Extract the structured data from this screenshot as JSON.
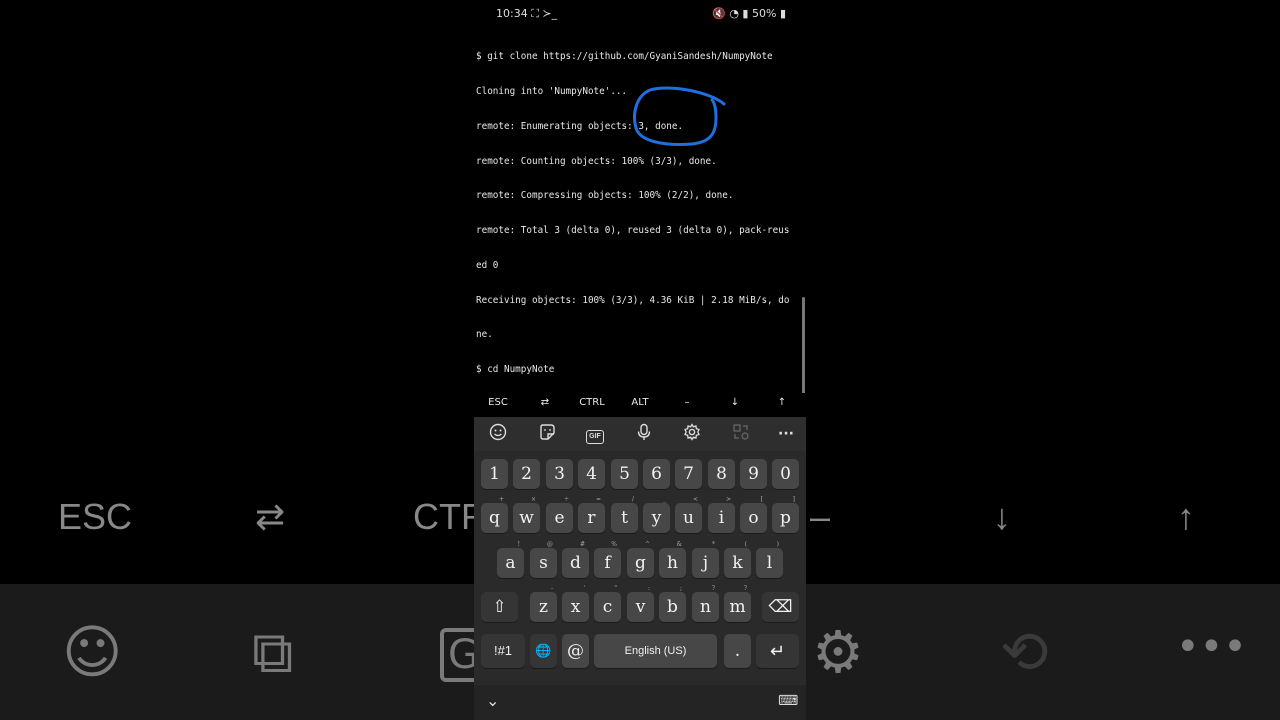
{
  "status_bar": {
    "time": "10:34",
    "notif_icons": "⛶ ≻_",
    "battery": "50%"
  },
  "terminal": {
    "lines": [
      "$ git clone https://github.com/GyaniSandesh/NumpyNote",
      "Cloning into 'NumpyNote'...",
      "remote: Enumerating objects: 3, done.",
      "remote: Counting objects: 100% (3/3), done.",
      "remote: Compressing objects: 100% (2/2), done.",
      "remote: Total 3 (delta 0), reused 3 (delta 0), pack-reus",
      "ed 0",
      "Receiving objects: 100% (3/3), 4.36 KiB | 2.18 MiB/s, do",
      "ne.",
      "$ cd NumpyNote",
      "$ "
    ]
  },
  "extra_keys": [
    "ESC",
    "⇄",
    "CTRL",
    "ALT",
    "–",
    "↓",
    "↑"
  ],
  "keyboard": {
    "toolbar_icons": [
      "emoji-icon",
      "sticker-icon",
      "gif-icon",
      "mic-icon",
      "settings-icon",
      "translate-icon",
      "more-icon"
    ],
    "gif_label": "GIF",
    "more_label": "···",
    "number_row": [
      "1",
      "2",
      "3",
      "4",
      "5",
      "6",
      "7",
      "8",
      "9",
      "0"
    ],
    "row1": [
      "q",
      "w",
      "e",
      "r",
      "t",
      "y",
      "u",
      "i",
      "o",
      "p"
    ],
    "row1_hints": [
      "+",
      "×",
      "÷",
      "=",
      "/",
      "_",
      "<",
      ">",
      "[",
      "]"
    ],
    "row2": [
      "a",
      "s",
      "d",
      "f",
      "g",
      "h",
      "j",
      "k",
      "l"
    ],
    "row2_hints": [
      "!",
      "@",
      "#",
      "%",
      "^",
      "&",
      "*",
      "(",
      ")"
    ],
    "row3": [
      "z",
      "x",
      "c",
      "v",
      "b",
      "n",
      "m"
    ],
    "row3_hints": [
      "-",
      "'",
      "\"",
      ":",
      ";",
      "?",
      "?"
    ],
    "shift": "⇧",
    "backspace": "⌫",
    "sym_label": "!#1",
    "lang_icon": "🌐",
    "at": "@",
    "space_label": "English (US)",
    "period": ".",
    "enter": "↵",
    "hide_icon": "⌄",
    "keyboard_icon": "⌨"
  },
  "background": {
    "extra_keys": [
      "ESC",
      "⇄",
      "CTR",
      "–",
      "↓",
      "↑"
    ],
    "tool_icons": [
      "☺",
      "⧉",
      "GI",
      "⚙",
      "⟲",
      "•••"
    ]
  },
  "colors": {
    "annotation": "#1f6fe0",
    "key": "#474747",
    "keyboard_bg": "#2a2a2a"
  }
}
